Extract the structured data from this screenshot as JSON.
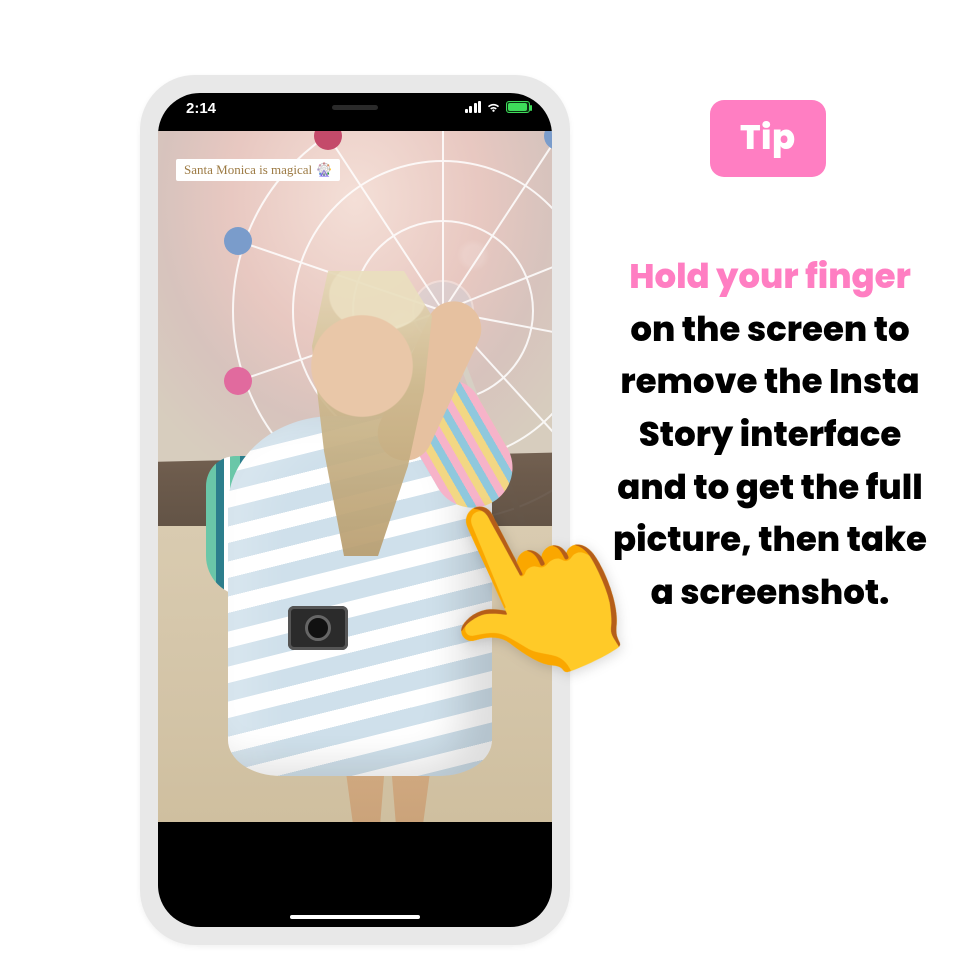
{
  "phone": {
    "status": {
      "time": "2:14"
    },
    "story": {
      "caption_text": "Santa Monica is magical",
      "caption_emoji": "🎡"
    }
  },
  "overlay": {
    "hand_emoji": "👆"
  },
  "tip": {
    "badge": "Tip",
    "accent": "Hold your finger",
    "rest": " on the screen to remove the Insta Story interface and to get the full picture, then take a screenshot."
  }
}
